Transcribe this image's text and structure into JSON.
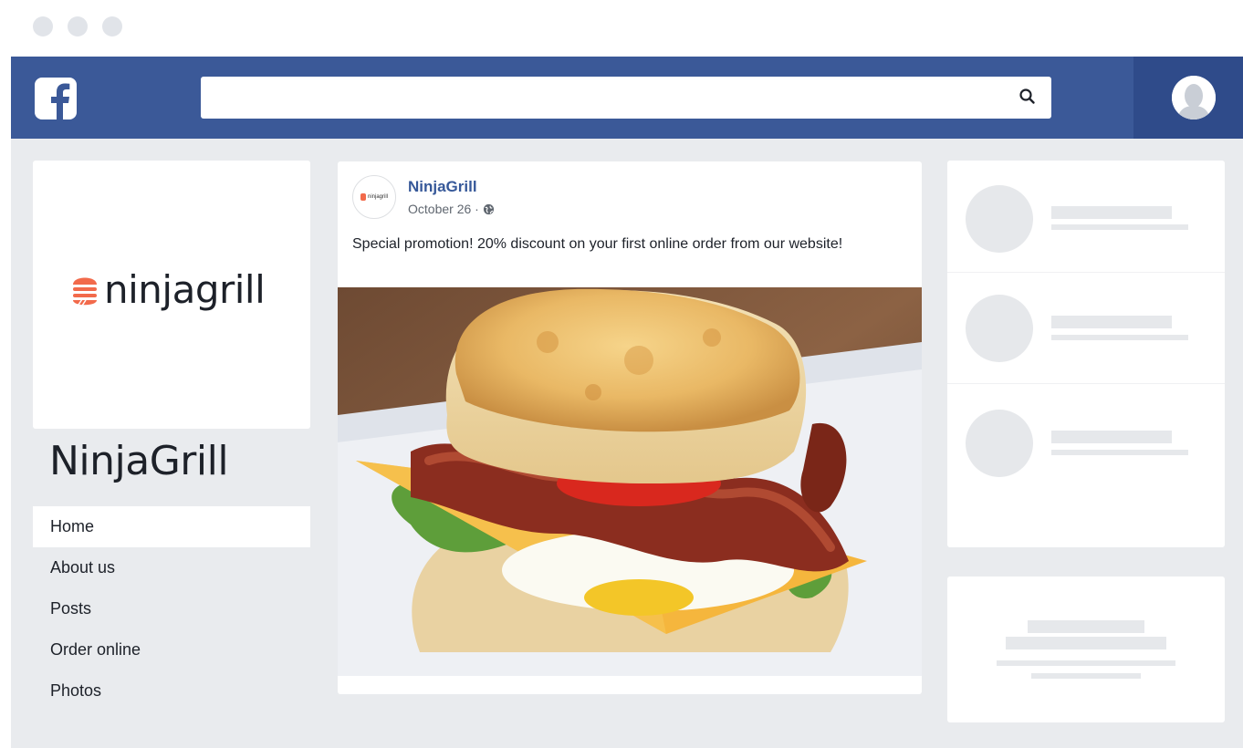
{
  "window": {
    "dots": [
      "#e1e4e9",
      "#e1e4e9",
      "#e1e4e9"
    ]
  },
  "topbar": {
    "bg_color": "#3b5998",
    "logo_icon": "facebook-f-icon",
    "search": {
      "value": "",
      "placeholder": "",
      "icon": "search-icon"
    },
    "profile_icon": "user-silhouette-icon"
  },
  "page": {
    "brand_logo_text": "ninjagrill",
    "brand_accent": "#f26a4b",
    "name": "NinjaGrill",
    "nav": [
      {
        "label": "Home",
        "active": true
      },
      {
        "label": "About us",
        "active": false
      },
      {
        "label": "Posts",
        "active": false
      },
      {
        "label": "Order online",
        "active": false
      },
      {
        "label": "Photos",
        "active": false
      }
    ]
  },
  "post": {
    "avatar_text": "ninjagrill",
    "author": "NinjaGrill",
    "date": "October 26 · ",
    "privacy_icon": "globe-icon",
    "text": "Special promotion! 20% discount on your first online order from our website!",
    "image_icon": "breakfast-sandwich-photo"
  }
}
